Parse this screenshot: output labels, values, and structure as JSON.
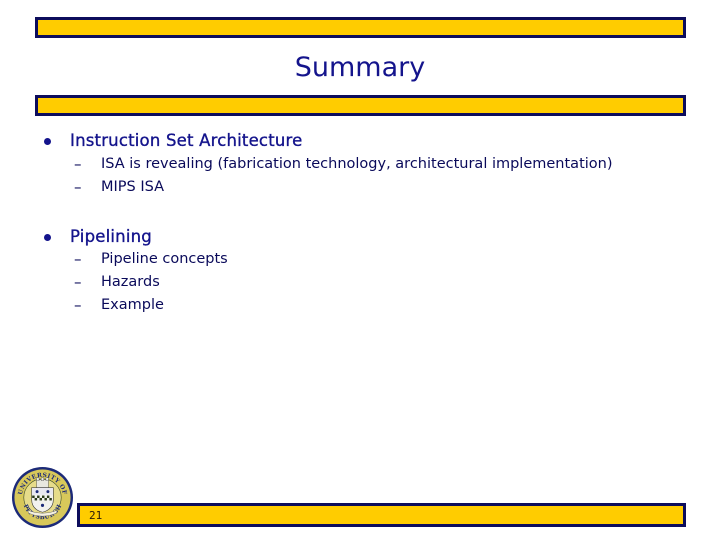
{
  "slide": {
    "title": "Summary",
    "page_number": "21",
    "colors": {
      "bar_fill": "#ffcc00",
      "bar_border": "#0d0d5c",
      "title": "#14148c",
      "body_text": "#0a0a5a"
    }
  },
  "bullets": [
    {
      "text": "Instruction Set Architecture",
      "subitems": [
        {
          "dash": "–",
          "text": "ISA is revealing (fabrication technology, architectural implementation)"
        },
        {
          "dash": "–",
          "text": "MIPS ISA"
        }
      ]
    },
    {
      "text": "Pipelining",
      "subitems": [
        {
          "dash": "–",
          "text": "Pipeline concepts"
        },
        {
          "dash": "–",
          "text": "Hazards"
        },
        {
          "dash": "–",
          "text": "Example"
        }
      ]
    }
  ],
  "logo": {
    "name": "university-seal",
    "top_text": "UNIVERSITY OF",
    "bottom_text": "PITTSBURGH"
  }
}
